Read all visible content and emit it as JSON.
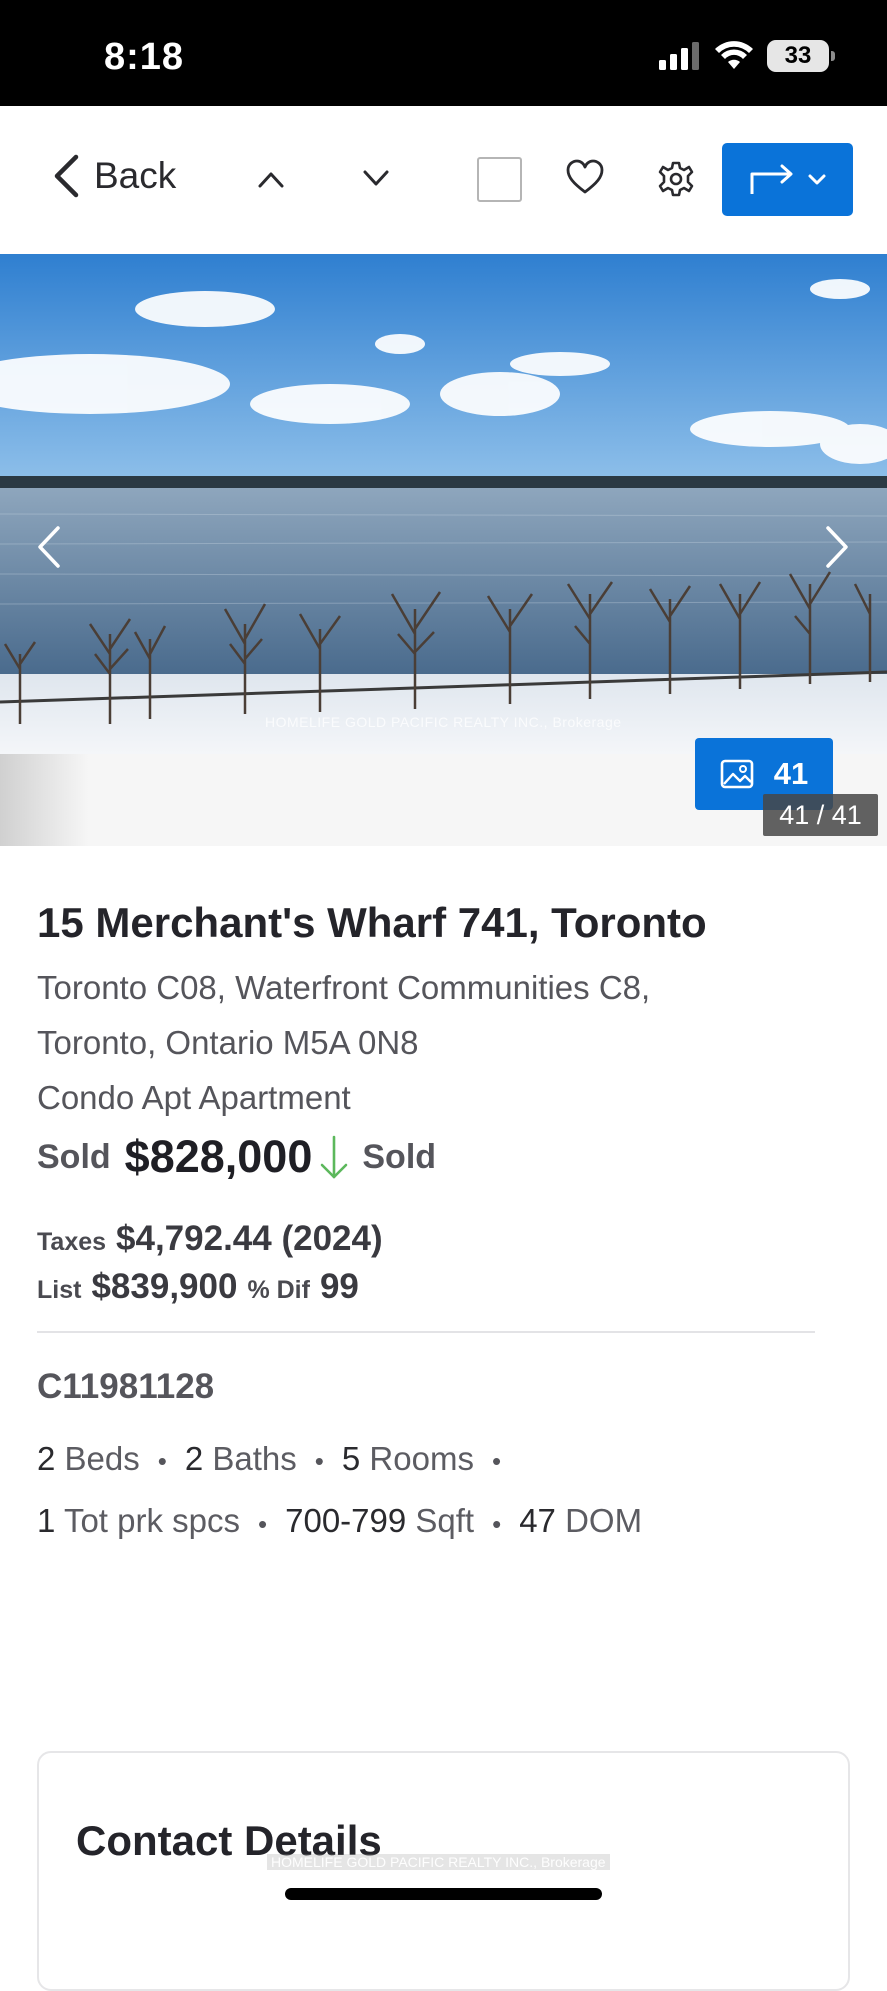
{
  "status_bar": {
    "time": "8:18",
    "battery": "33"
  },
  "toolbar": {
    "back_label": "Back",
    "icons": [
      "chevron-left-icon",
      "chevron-up-icon",
      "chevron-down-icon",
      "checkbox",
      "heart-icon",
      "gear-icon",
      "share-icon"
    ]
  },
  "gallery": {
    "watermark": "HOMELIFE GOLD PACIFIC REALTY INC., Brokerage",
    "photo_count": "41",
    "photo_index": "41 / 41"
  },
  "listing": {
    "address": "15 Merchant's Wharf 741, Toronto",
    "area_line_1": "Toronto C08, Waterfront Communities C8,",
    "area_line_2": "Toronto, Ontario M5A 0N8",
    "type": "Condo Apt Apartment",
    "sold_label": "Sold",
    "sold_price": "$828,000",
    "sold_status": "Sold",
    "taxes_label": "Taxes",
    "taxes_value": "$4,792.44 (2024)",
    "list_label": "List",
    "list_value": "$839,900",
    "dif_label": "% Dif",
    "dif_value": "99",
    "mls": "C11981128",
    "beds_num": "2",
    "beds_label": "Beds",
    "baths_num": "2",
    "baths_label": "Baths",
    "rooms_num": "5",
    "rooms_label": "Rooms",
    "parking_num": "1",
    "parking_label": "Tot prk spcs",
    "sqft_num": "700-799",
    "sqft_label": "Sqft",
    "dom_num": "47",
    "dom_label": "DOM"
  },
  "contact": {
    "title": "Contact Details",
    "watermark": "HOMELIFE GOLD PACIFIC REALTY INC., Brokerage"
  },
  "colors": {
    "accent": "#0a73d9",
    "price_drop": "#5cb85c"
  }
}
